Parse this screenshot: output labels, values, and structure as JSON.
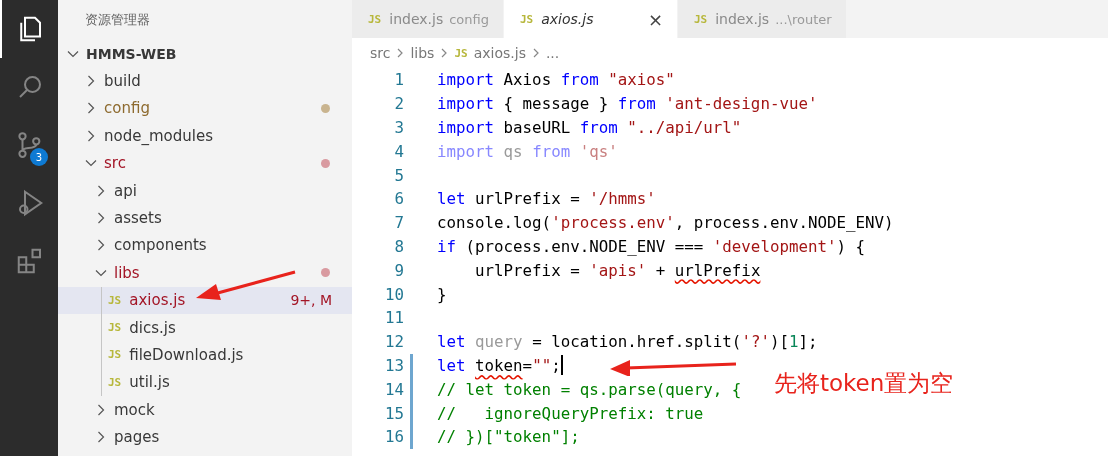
{
  "activity_bar": [
    {
      "kind": "explorer",
      "selected": true
    },
    {
      "kind": "search",
      "selected": false
    },
    {
      "kind": "source-control",
      "selected": false,
      "badge": "3"
    },
    {
      "kind": "run",
      "selected": false
    },
    {
      "kind": "extensions",
      "selected": false
    }
  ],
  "sidebar": {
    "title": "资源管理器",
    "root": {
      "label": "HMMS-WEB",
      "kind": "folder",
      "expanded": true,
      "children": [
        {
          "label": "build",
          "kind": "folder",
          "expanded": false
        },
        {
          "label": "config",
          "kind": "folder",
          "expanded": false,
          "changed": true,
          "color": "#c9b48f"
        },
        {
          "label": "node_modules",
          "kind": "folder",
          "expanded": false
        },
        {
          "label": "src",
          "kind": "folder",
          "expanded": true,
          "modified": true,
          "color": "#d99aa0",
          "children": [
            {
              "label": "api",
              "kind": "folder",
              "expanded": false
            },
            {
              "label": "assets",
              "kind": "folder",
              "expanded": false
            },
            {
              "label": "components",
              "kind": "folder",
              "expanded": false
            },
            {
              "label": "libs",
              "kind": "folder",
              "expanded": true,
              "modified": true,
              "color": "#d99aa0",
              "children": [
                {
                  "label": "axios.js",
                  "kind": "file",
                  "type_label": "JS",
                  "selected": true,
                  "modified": true,
                  "badge": "9+, M"
                },
                {
                  "label": "dics.js",
                  "kind": "file",
                  "type_label": "JS",
                  "selected": false
                },
                {
                  "label": "fileDownload.js",
                  "kind": "file",
                  "type_label": "JS",
                  "selected": false
                },
                {
                  "label": "util.js",
                  "kind": "file",
                  "type_label": "JS",
                  "selected": false
                }
              ]
            },
            {
              "label": "mock",
              "kind": "folder",
              "expanded": false
            },
            {
              "label": "pages",
              "kind": "folder",
              "expanded": false
            }
          ]
        }
      ]
    }
  },
  "tabs": [
    {
      "type_label": "JS",
      "label": "index.js",
      "description": "config",
      "selected": false,
      "preview": false
    },
    {
      "type_label": "JS",
      "label": "axios.js",
      "close": "×",
      "selected": true,
      "preview": true
    },
    {
      "type_label": "JS",
      "label": "index.js",
      "description": "...\\router",
      "selected": false,
      "preview": false
    }
  ],
  "breadcrumb": [
    {
      "label": "src"
    },
    {
      "label": "libs"
    },
    {
      "label": "axios.js",
      "type_label": "JS"
    },
    {
      "label": "..."
    }
  ],
  "code_lines": [
    {
      "number": "1",
      "tokens": [
        {
          "text": "import",
          "kind": "kw"
        },
        {
          "text": " Axios ",
          "kind": "plain"
        },
        {
          "text": "from",
          "kind": "kw"
        },
        {
          "text": " \"axios\"",
          "kind": "str"
        }
      ]
    },
    {
      "number": "2",
      "tokens": [
        {
          "text": "import",
          "kind": "kw"
        },
        {
          "text": " { message } ",
          "kind": "plain"
        },
        {
          "text": "from",
          "kind": "kw"
        },
        {
          "text": " 'ant-design-vue'",
          "kind": "str"
        }
      ]
    },
    {
      "number": "3",
      "tokens": [
        {
          "text": "import",
          "kind": "kw"
        },
        {
          "text": " baseURL ",
          "kind": "plain"
        },
        {
          "text": "from",
          "kind": "kw"
        },
        {
          "text": " \"../api/url\"",
          "kind": "str"
        }
      ]
    },
    {
      "number": "4",
      "tokens": [
        {
          "text": "import",
          "kind": "faded-kw"
        },
        {
          "text": " qs ",
          "kind": "faded"
        },
        {
          "text": "from",
          "kind": "faded-kw"
        },
        {
          "text": " 'qs'",
          "kind": "faded-str"
        }
      ]
    },
    {
      "number": "5"
    },
    {
      "number": "6",
      "tokens": [
        {
          "text": "let",
          "kind": "kw"
        },
        {
          "text": " urlPrefix = ",
          "kind": "plain"
        },
        {
          "text": "'/hmms'",
          "kind": "str"
        }
      ]
    },
    {
      "number": "7",
      "tokens": [
        {
          "text": "console.log(",
          "kind": "plain"
        },
        {
          "text": "'process.env'",
          "kind": "str"
        },
        {
          "text": ", process.env.NODE_ENV)",
          "kind": "plain"
        }
      ]
    },
    {
      "number": "8",
      "tokens": [
        {
          "text": "if",
          "kind": "kw"
        },
        {
          "text": " (process.env.NODE_ENV === ",
          "kind": "plain"
        },
        {
          "text": "'development'",
          "kind": "str"
        },
        {
          "text": ") {",
          "kind": "plain"
        }
      ]
    },
    {
      "number": "9",
      "tokens": [
        {
          "text": "    urlPrefix = ",
          "kind": "plain"
        },
        {
          "text": "'apis'",
          "kind": "str"
        },
        {
          "text": " + ",
          "kind": "plain"
        },
        {
          "text": "urlPrefix",
          "kind": "plain",
          "squiggle": true
        }
      ]
    },
    {
      "number": "10",
      "tokens": [
        {
          "text": "}",
          "kind": "plain"
        }
      ]
    },
    {
      "number": "11"
    },
    {
      "number": "12",
      "tokens": [
        {
          "text": "let",
          "kind": "kw"
        },
        {
          "text": " query",
          "kind": "faded"
        },
        {
          "text": " = location.href.split(",
          "kind": "plain"
        },
        {
          "text": "'?'",
          "kind": "str"
        },
        {
          "text": ")[",
          "kind": "plain"
        },
        {
          "text": "1",
          "kind": "num"
        },
        {
          "text": "];",
          "kind": "plain"
        }
      ]
    },
    {
      "number": "13",
      "modified": true,
      "cursor": true,
      "tokens": [
        {
          "text": "let ",
          "kind": "kw"
        },
        {
          "text": "token",
          "kind": "plain",
          "squiggle": true
        },
        {
          "text": "=",
          "kind": "plain"
        },
        {
          "text": "\"\"",
          "kind": "str"
        },
        {
          "text": ";",
          "kind": "plain"
        }
      ]
    },
    {
      "number": "14",
      "modified": true,
      "tokens": [
        {
          "text": "// let token = qs.parse(query, {",
          "kind": "comment"
        }
      ]
    },
    {
      "number": "15",
      "modified": true,
      "tokens": [
        {
          "text": "//   ignoreQueryPrefix: true",
          "kind": "comment"
        }
      ]
    },
    {
      "number": "16",
      "modified": true,
      "tokens": [
        {
          "text": "// })[\"token\"];",
          "kind": "comment"
        }
      ]
    }
  ],
  "annotation": {
    "text": "先将token置为空"
  }
}
